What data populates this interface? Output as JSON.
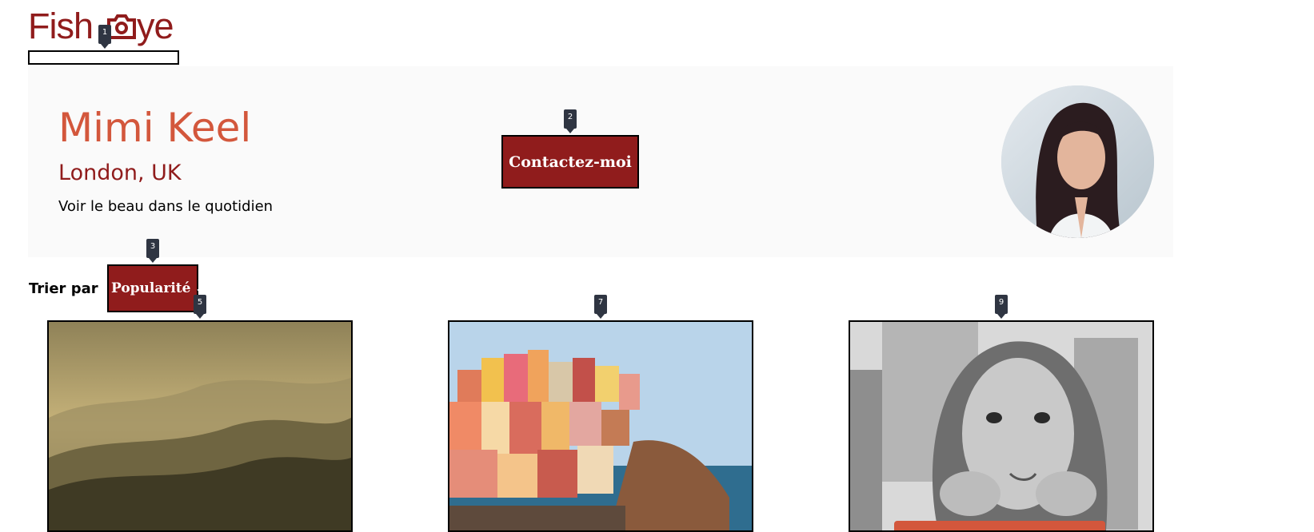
{
  "logo": {
    "text_left": "Fish",
    "text_right": "ye",
    "brand_color": "#901c1c"
  },
  "markers": [
    "1",
    "2",
    "3",
    "5",
    "7",
    "9"
  ],
  "photographer": {
    "name": "Mimi Keel",
    "location": "London, UK",
    "tagline": "Voir le beau dans le quotidien",
    "contact_label": "Contactez-moi",
    "accent_color": "#d3573c"
  },
  "sort": {
    "label": "Trier par",
    "selected": "Popularité"
  },
  "gallery": [
    {
      "subject": "misty mountain landscape"
    },
    {
      "subject": "colorful cliffside village by the sea"
    },
    {
      "subject": "black and white portrait of a child"
    }
  ]
}
